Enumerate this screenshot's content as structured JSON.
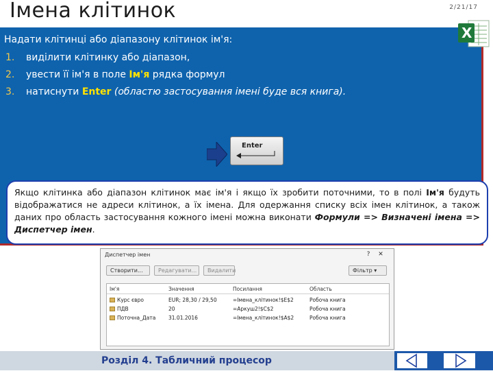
{
  "slide": {
    "title": "Імена клітинок",
    "date": "2/21/17",
    "intro": "Надати клітинці або діапазону клітинок ім'я:",
    "steps": [
      {
        "num": "1.",
        "text": "виділити клітинку або діапазон,"
      },
      {
        "num": "2.",
        "pre": "увести її ім'я в поле ",
        "hl": "Ім'я",
        "post": " рядка формул"
      },
      {
        "num": "3.",
        "pre": "натиснути ",
        "hl": "Enter",
        "it": " (областю застосування імені буде вся книга)."
      }
    ],
    "enter_key_label": "Enter",
    "note": {
      "part1": "Якщо клітинка або діапазон клітинок має ім'я і якщо їх зробити поточними, то в полі ",
      "bold1": "Ім'я",
      "part2": " будуть відображатися не адреси клітинок, а їх імена. Для одержання списку всіх імен клітинок, а також даних про область застосування кожного імені можна виконати ",
      "bold2": "Формули => Визначені імена => Диспетчер імен",
      "end": "."
    },
    "footer": "Розділ 4. Табличний процесор"
  },
  "dialog": {
    "title": "Диспетчер імен",
    "buttons": [
      "Створити...",
      "Редагувати...",
      "Видалити"
    ],
    "filter": "Фільтр",
    "columns": [
      "Ім'я",
      "Значення",
      "Посилання",
      "Область"
    ],
    "rows": [
      [
        "Курс євро",
        "EUR; 28,30 / 29,50",
        "=Імена_клітинок!$E$2",
        "Робоча книга"
      ],
      [
        "ПДВ",
        "20",
        "=Аркуш2!$C$2",
        "Робоча книга"
      ],
      [
        "Поточна_Дата",
        "31.01.2016",
        "=Імена_клітинок!$A$2",
        "Робоча книга"
      ]
    ]
  },
  "colors": {
    "panel": "#0f63ad",
    "panel_border": "#b12a2a",
    "highlight": "#ffe200",
    "note_border": "#1d3fae",
    "footer_text": "#233f8f",
    "nav_bar": "#1c58a9"
  },
  "icons": [
    "excel-logo-icon",
    "arrow-right-icon",
    "enter-key-icon",
    "prev-slide-icon",
    "next-slide-icon"
  ]
}
